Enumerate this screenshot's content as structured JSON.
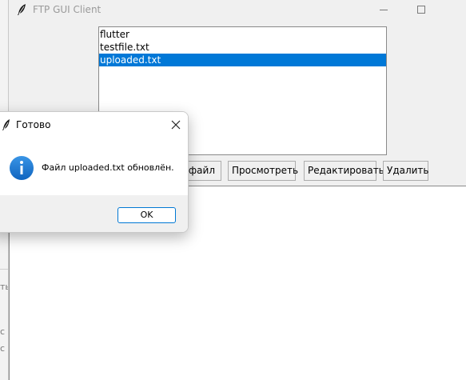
{
  "window": {
    "title": "FTP GUI Client",
    "icon": "feather-icon"
  },
  "file_list": {
    "items": [
      "flutter",
      "testfile.txt",
      "uploaded.txt"
    ],
    "selected_index": 2
  },
  "buttons": {
    "upload_label": "файл",
    "view_label": "Просмотреть",
    "edit_label": "Редактировать",
    "delete_label": "Удалить"
  },
  "dialog": {
    "title": "Готово",
    "icon": "info-icon",
    "message": "Файл uploaded.txt обновлён.",
    "ok_label": "OK"
  },
  "background_window": {
    "glyph_a": "ть",
    "glyph_b": "с",
    "glyph_c": "с"
  },
  "colors": {
    "selection": "#0078d7",
    "info_icon": "#1a73c8",
    "ok_border": "#0078d4"
  }
}
